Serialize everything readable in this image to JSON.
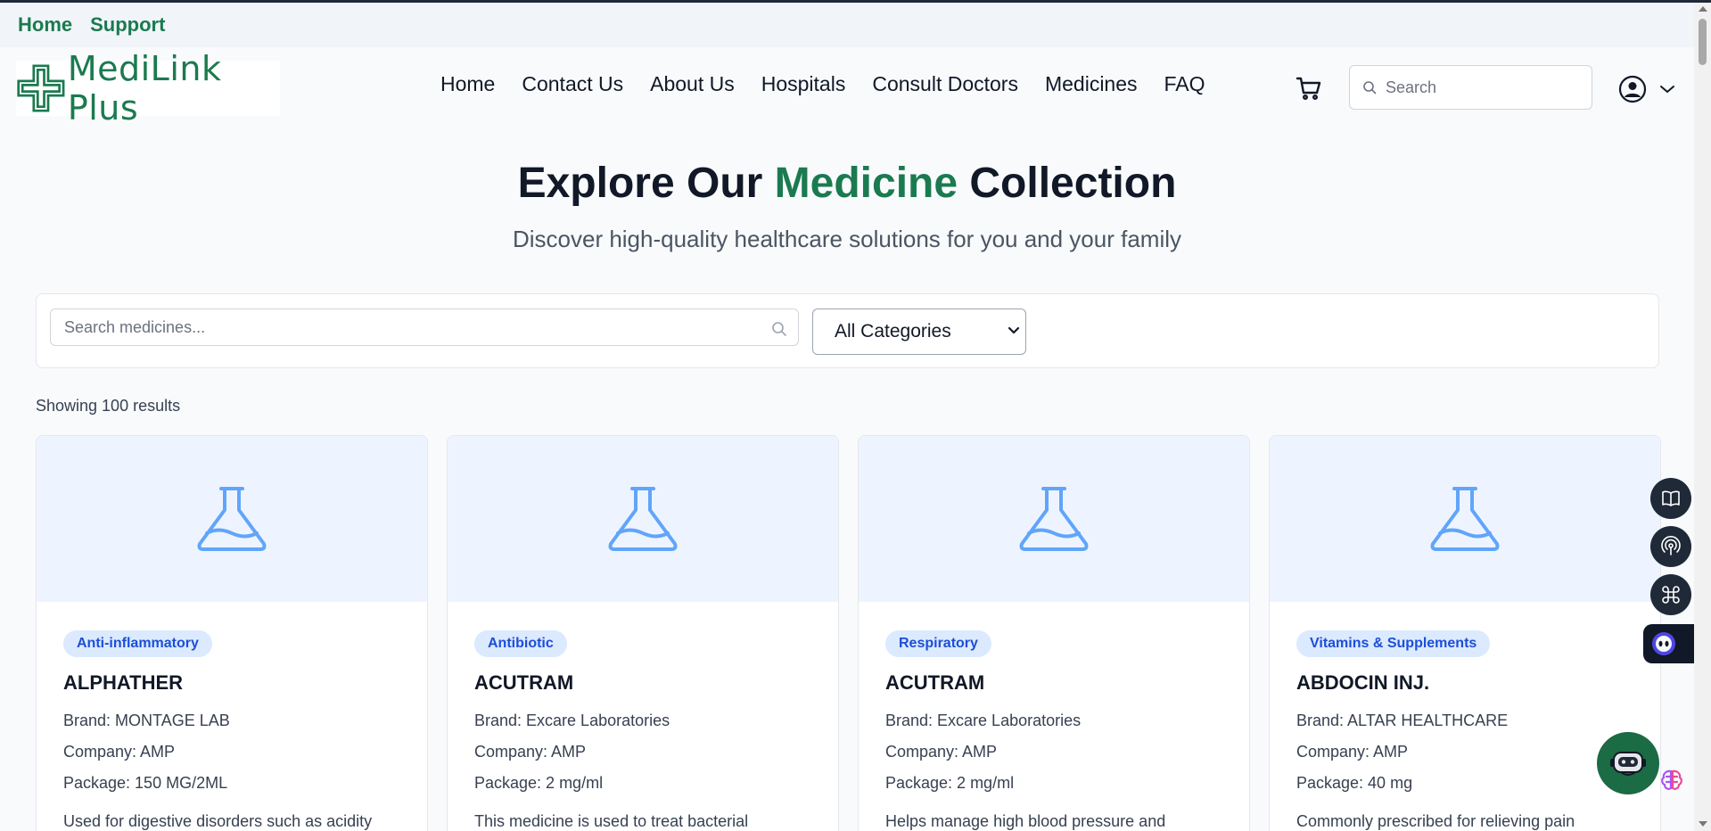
{
  "utility_nav": {
    "home": "Home",
    "support": "Support"
  },
  "brand": {
    "name": "MediLink Plus",
    "color": "#1b7a4f"
  },
  "main_nav": [
    "Home",
    "Contact Us",
    "About Us",
    "Hospitals",
    "Consult Doctors",
    "Medicines",
    "FAQ"
  ],
  "search": {
    "placeholder": "Search"
  },
  "hero": {
    "title_pre": "Explore Our",
    "title_accent": "Medicine",
    "title_post": "Collection",
    "subtitle": "Discover high-quality healthcare solutions for you and your family"
  },
  "filters": {
    "search_placeholder": "Search medicines...",
    "category_selected": "All Categories"
  },
  "results": {
    "count_text": "Showing 100 results"
  },
  "products": [
    {
      "category": "Anti-inflammatory",
      "name": "ALPHATHER",
      "brand": "Brand: MONTAGE LAB",
      "company": "Company: AMP",
      "package": "Package: 150 MG/2ML",
      "description": "Used for digestive disorders such as acidity"
    },
    {
      "category": "Antibiotic",
      "name": "ACUTRAM",
      "brand": "Brand: Excare Laboratories",
      "company": "Company: AMP",
      "package": "Package: 2 mg/ml",
      "description": "This medicine is used to treat bacterial"
    },
    {
      "category": "Respiratory",
      "name": "ACUTRAM",
      "brand": "Brand: Excare Laboratories",
      "company": "Company: AMP",
      "package": "Package: 2 mg/ml",
      "description": "Helps manage high blood pressure and"
    },
    {
      "category": "Vitamins & Supplements",
      "name": "ABDOCIN INJ.",
      "brand": "Brand: ALTAR HEALTHCARE",
      "company": "Company: AMP",
      "package": "Package: 40 mg",
      "description": "Commonly prescribed for relieving pain"
    }
  ],
  "icons": {
    "cart": "cart-icon",
    "user": "user-circle-icon",
    "product_image": "flask-icon",
    "side_tools": [
      "book-icon",
      "broadcast-icon",
      "command-icon"
    ],
    "assistant": "ai-assistant-icon",
    "chat": "chatbot-icon"
  }
}
